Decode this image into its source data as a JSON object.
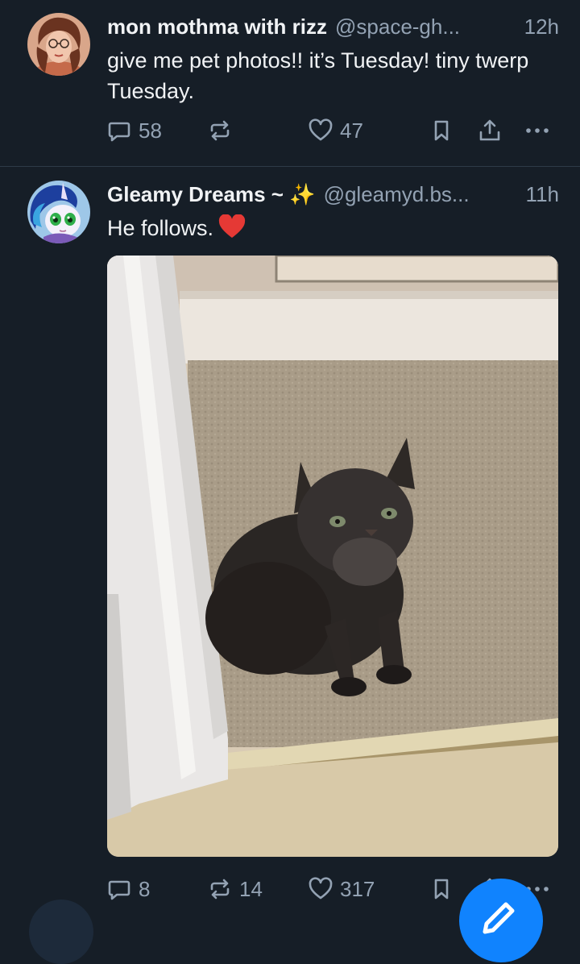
{
  "feed": {
    "posts": [
      {
        "author_name": "mon mothma with rizz",
        "handle": "@space-gh...",
        "time": "12h",
        "text": "give me pet photos!! it’s Tuesday! tiny twerp Tuesday.",
        "avatar": "avatar-woman-glasses",
        "reply_count": "58",
        "repost_count": "",
        "like_count": "47"
      },
      {
        "author_name": "Gleamy Dreams ~ ✨",
        "handle": "@gleamyd.bs...",
        "time": "11h",
        "text": "He follows.",
        "text_emoji": "red-heart",
        "avatar": "avatar-unicorn-pony",
        "image": "photo-gray-kitten-on-carpet",
        "reply_count": "8",
        "repost_count": "14",
        "like_count": "317"
      }
    ]
  },
  "icons": {
    "reply": "reply-icon",
    "repost": "repost-icon",
    "like": "heart-icon",
    "bookmark": "bookmark-icon",
    "share": "share-icon",
    "more": "more-icon",
    "compose": "compose-icon"
  },
  "colors": {
    "background": "#161e27",
    "text": "#f1f3f5",
    "muted": "#93a2b3",
    "accent": "#1083fe",
    "heart": "#e53935"
  }
}
